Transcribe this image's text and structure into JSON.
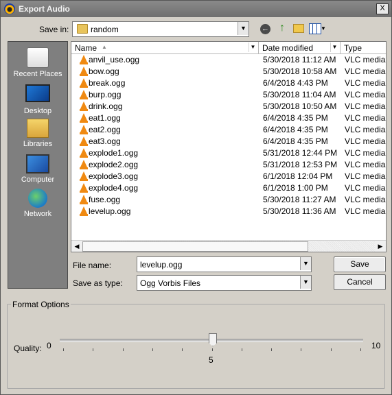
{
  "window": {
    "title": "Export Audio",
    "close_label": "X"
  },
  "save_in": {
    "label": "Save in:",
    "value": "random"
  },
  "toolbar": {
    "back_icon": "back-arrow-icon",
    "up_icon": "up-folder-icon",
    "new_folder_icon": "new-folder-icon",
    "view_icon": "view-menu-icon"
  },
  "places": [
    {
      "label": "Recent Places",
      "icon": "recent-places-icon"
    },
    {
      "label": "Desktop",
      "icon": "desktop-icon"
    },
    {
      "label": "Libraries",
      "icon": "libraries-icon"
    },
    {
      "label": "Computer",
      "icon": "computer-icon"
    },
    {
      "label": "Network",
      "icon": "network-icon"
    }
  ],
  "columns": {
    "name": "Name",
    "date": "Date modified",
    "type": "Type"
  },
  "files": [
    {
      "name": "anvil_use.ogg",
      "date": "5/30/2018 11:12 AM",
      "type": "VLC media file"
    },
    {
      "name": "bow.ogg",
      "date": "5/30/2018 10:58 AM",
      "type": "VLC media file"
    },
    {
      "name": "break.ogg",
      "date": "6/4/2018 4:43 PM",
      "type": "VLC media file"
    },
    {
      "name": "burp.ogg",
      "date": "5/30/2018 11:04 AM",
      "type": "VLC media file"
    },
    {
      "name": "drink.ogg",
      "date": "5/30/2018 10:50 AM",
      "type": "VLC media file"
    },
    {
      "name": "eat1.ogg",
      "date": "6/4/2018 4:35 PM",
      "type": "VLC media file"
    },
    {
      "name": "eat2.ogg",
      "date": "6/4/2018 4:35 PM",
      "type": "VLC media file"
    },
    {
      "name": "eat3.ogg",
      "date": "6/4/2018 4:35 PM",
      "type": "VLC media file"
    },
    {
      "name": "explode1.ogg",
      "date": "5/31/2018 12:44 PM",
      "type": "VLC media file"
    },
    {
      "name": "explode2.ogg",
      "date": "5/31/2018 12:53 PM",
      "type": "VLC media file"
    },
    {
      "name": "explode3.ogg",
      "date": "6/1/2018 12:04 PM",
      "type": "VLC media file"
    },
    {
      "name": "explode4.ogg",
      "date": "6/1/2018 1:00 PM",
      "type": "VLC media file"
    },
    {
      "name": "fuse.ogg",
      "date": "5/30/2018 11:27 AM",
      "type": "VLC media file"
    },
    {
      "name": "levelup.ogg",
      "date": "5/30/2018 11:36 AM",
      "type": "VLC media file"
    }
  ],
  "file_name": {
    "label": "File name:",
    "value": "levelup.ogg"
  },
  "save_type": {
    "label": "Save as type:",
    "value": "Ogg Vorbis Files"
  },
  "buttons": {
    "save": "Save",
    "cancel": "Cancel"
  },
  "format_options": {
    "title": "Format Options",
    "quality_label": "Quality:",
    "min": "0",
    "max": "10",
    "value": "5",
    "value_fraction": 0.5
  }
}
